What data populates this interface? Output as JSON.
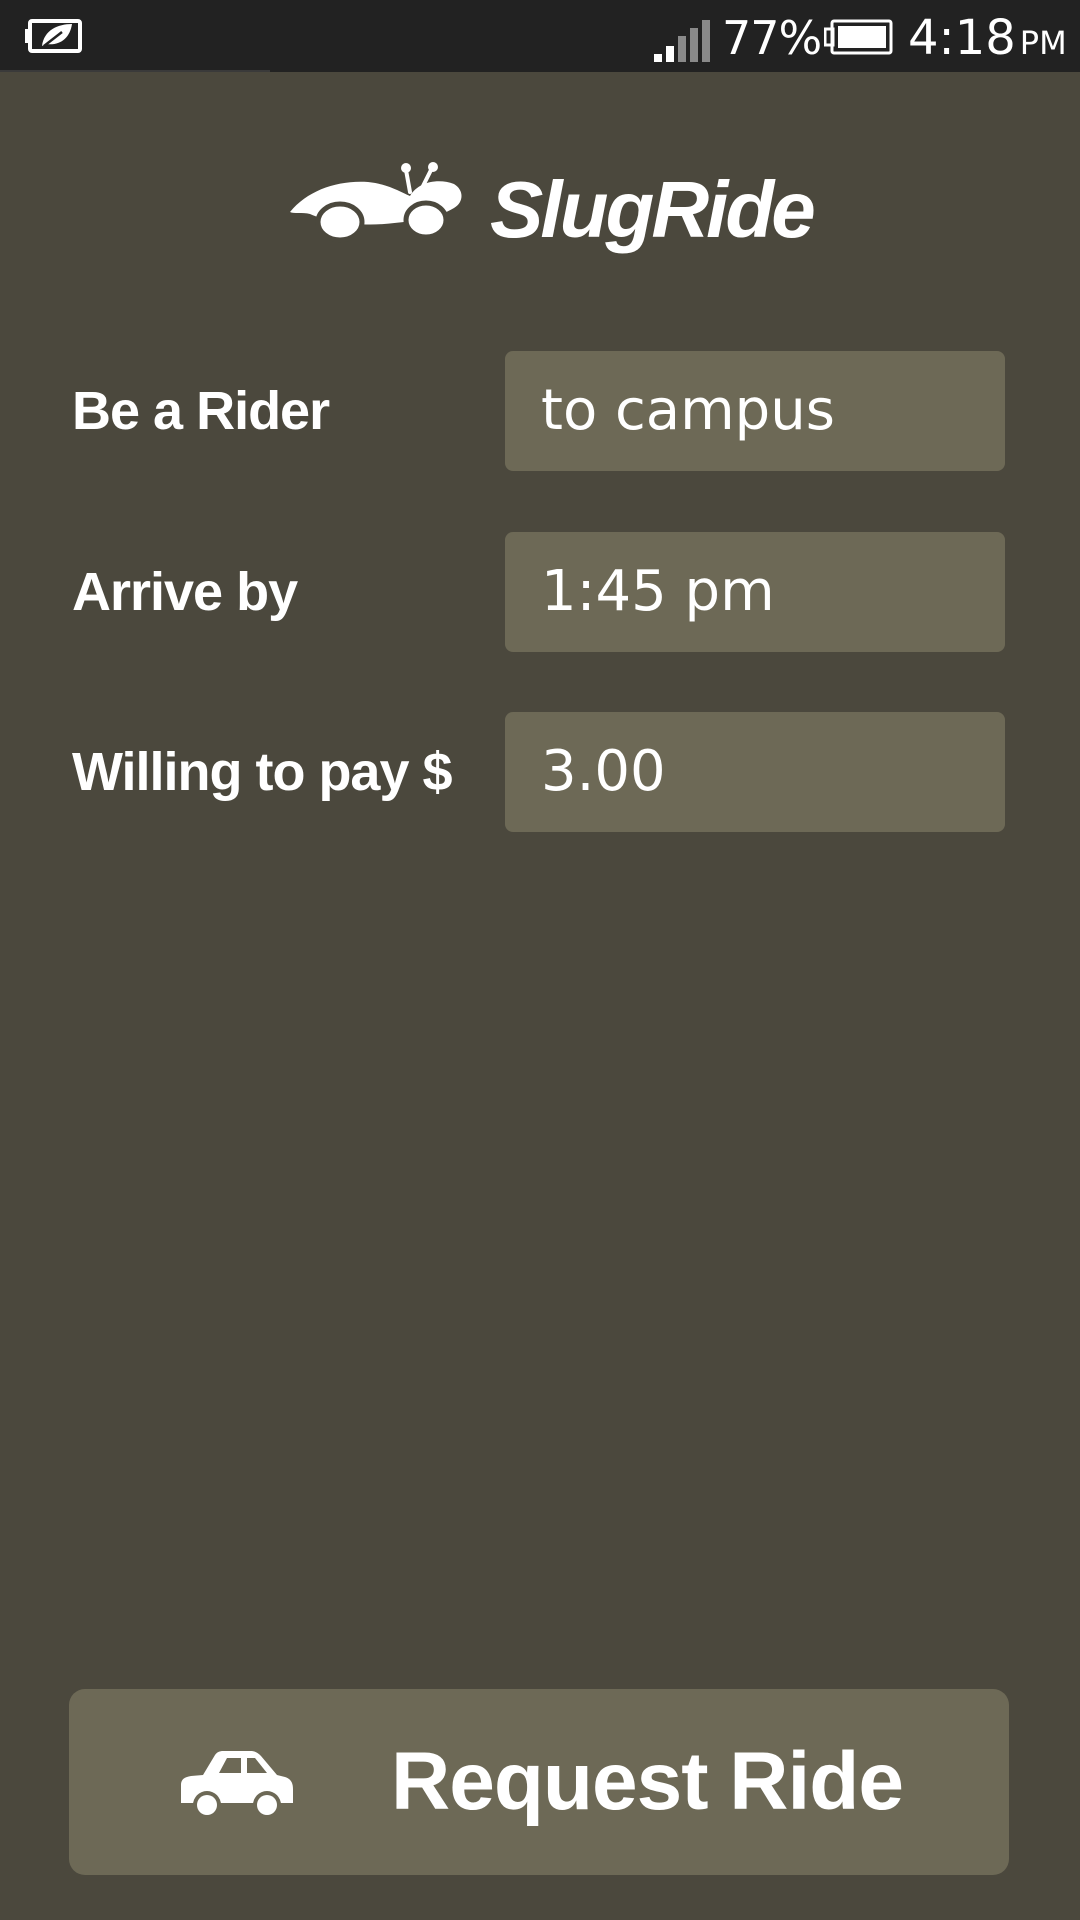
{
  "status_bar": {
    "battery_percent": "77%",
    "time": "4:18",
    "time_period": "PM",
    "icons": [
      "eco-battery-icon",
      "signal-icon",
      "battery-icon"
    ]
  },
  "app": {
    "brand_name": "SlugRide",
    "logo_icon": "slug-car-icon"
  },
  "form": {
    "rider": {
      "label": "Be a Rider",
      "value": "to campus"
    },
    "arrive": {
      "label": "Arrive by",
      "value": "1:45 pm"
    },
    "pay": {
      "label": "Willing to pay $",
      "value": "3.00"
    }
  },
  "request_button": {
    "label": "Request Ride",
    "icon": "car-icon"
  },
  "colors": {
    "background": "#4b483d",
    "field": "#6d6956",
    "status_bar": "#222222",
    "text": "#ffffff"
  }
}
